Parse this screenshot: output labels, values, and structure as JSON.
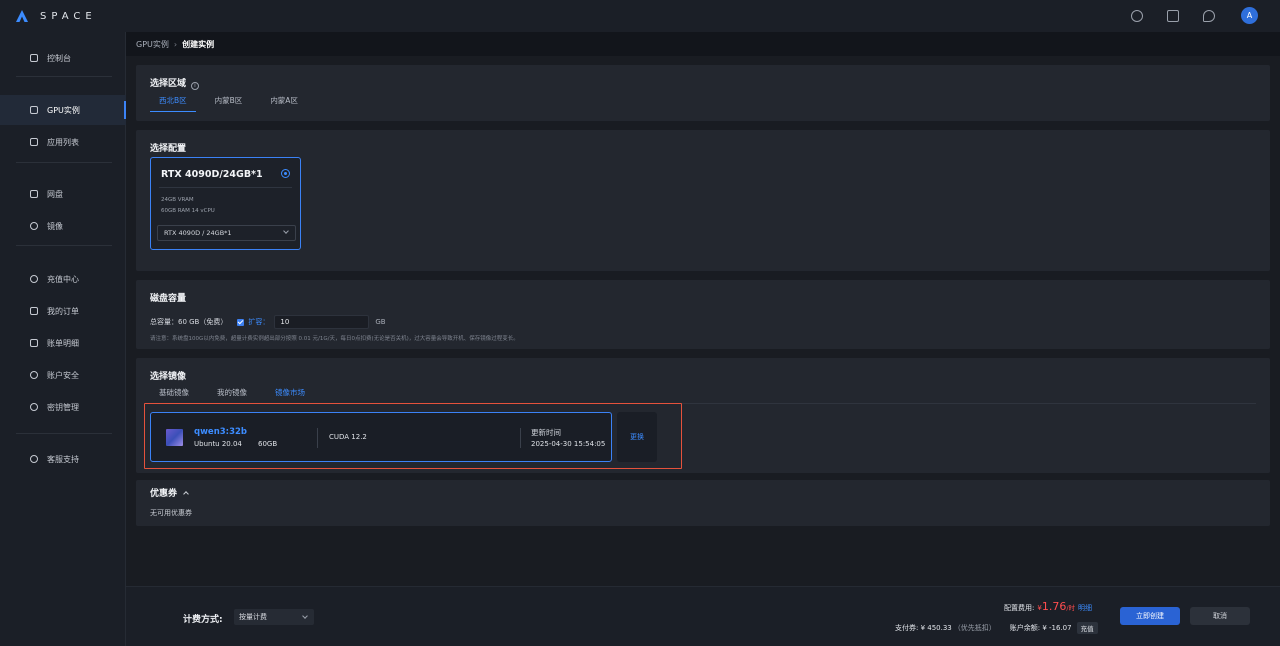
{
  "app": {
    "logo_text": "SPACE"
  },
  "header": {
    "avatar_letter": "A"
  },
  "sidebar": {
    "items": [
      {
        "label": "控制台"
      },
      {
        "label": "GPU实例"
      },
      {
        "label": "应用列表"
      },
      {
        "label": "网盘"
      },
      {
        "label": "镜像"
      },
      {
        "label": "充值中心"
      },
      {
        "label": "我的订单"
      },
      {
        "label": "账单明细"
      },
      {
        "label": "账户安全"
      },
      {
        "label": "密钥管理"
      },
      {
        "label": "客服支持"
      }
    ]
  },
  "breadcrumb": {
    "parent": "GPU实例",
    "current": "创建实例"
  },
  "region": {
    "title": "选择区域",
    "tabs": [
      "西北B区",
      "内蒙B区",
      "内蒙A区"
    ]
  },
  "config": {
    "title": "选择配置",
    "gpu_name": "RTX 4090D/24GB*1",
    "vram": "24GB VRAM",
    "ram_cpu": "60GB RAM 14 vCPU",
    "selected": "RTX 4090D / 24GB*1"
  },
  "disk": {
    "title": "磁盘容量",
    "total": "总容量：60 GB（免费）",
    "expand_label": "扩容：",
    "expand_value": "10",
    "unit": "GB",
    "note": "请注意：系统盘100G以内免费，超量计费实例超出部分按照 0.01 元/1G/天，每日0点扣费(无论是否关机)，过大容量会导致开机、保存镜像过程变长。"
  },
  "image": {
    "title": "选择镜像",
    "tabs": [
      "基础镜像",
      "我的镜像",
      "镜像市场"
    ],
    "name": "qwen3:32b",
    "os": "Ubuntu 20.04",
    "size": "60GB",
    "cuda": "CUDA 12.2",
    "time_label": "更新时间",
    "time": "2025-04-30 15:54:05",
    "change": "更换"
  },
  "coupon": {
    "title": "优惠券",
    "none": "无可用优惠券"
  },
  "footer": {
    "billing_label": "计费方式:",
    "billing_value": "按量计费",
    "fee_label": "配置费用:",
    "fee_currency": "¥",
    "fee_value": "1.76",
    "fee_unit": "/时",
    "fee_detail": "明细",
    "pay_label": "支付券: ¥ 450.33",
    "pay_note": "（优先抵扣）",
    "balance": "账户余额: ¥ -16.07",
    "recharge": "充值",
    "create": "立即创建",
    "cancel": "取消"
  },
  "colors": {
    "accent": "#3c8cff",
    "price": "#ff4d4f",
    "highlight": "#e5523c"
  }
}
